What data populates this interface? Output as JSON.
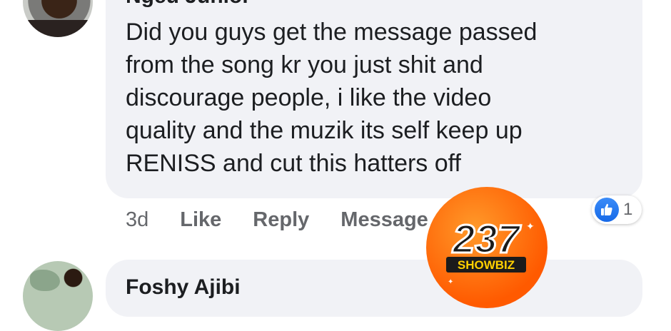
{
  "comments": [
    {
      "author": "Ngeu Junior",
      "text": "Did you guys get the message passed\nfrom the song kr you just shit and\ndiscourage people, i like the video\nquality and the muzik its self keep up\nRENISS and cut this hatters off",
      "time": "3d",
      "like_label": "Like",
      "reply_label": "Reply",
      "message_label": "Message",
      "reaction_count": "1",
      "reaction_icon": "thumbs-up-icon"
    },
    {
      "author": "Foshy Ajibi"
    }
  ],
  "watermark": {
    "number": "237",
    "word": "SHOWBIZ"
  },
  "colors": {
    "bubble": "#f1f2f6",
    "like_blue": "#1877f2",
    "action_gray": "#65676b",
    "watermark_orange": "#ff5a00"
  }
}
